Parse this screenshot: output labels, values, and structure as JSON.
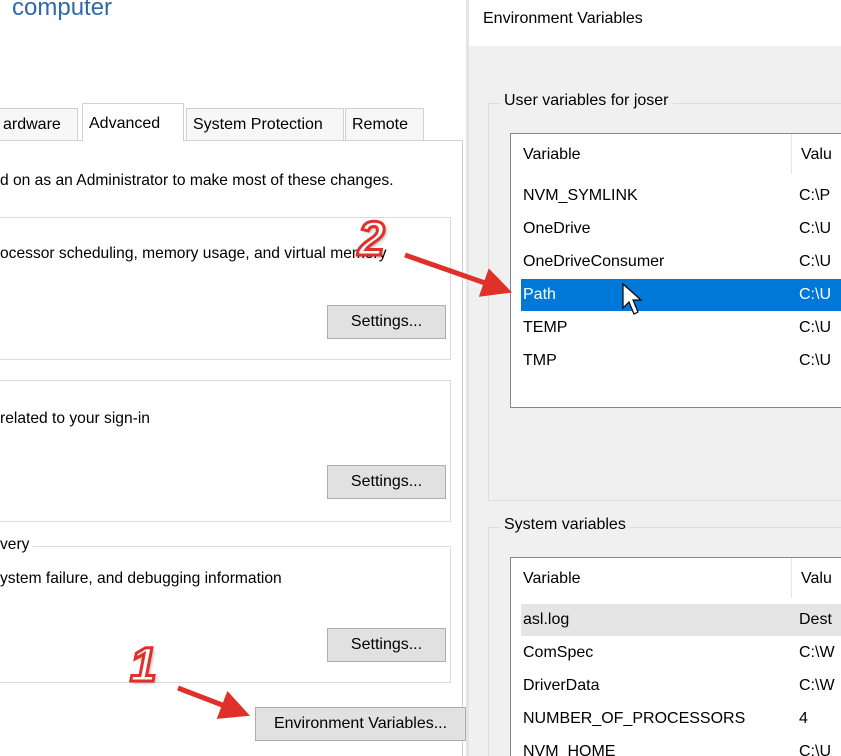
{
  "system_properties": {
    "title": "computer",
    "tabs": [
      {
        "label": "ardware",
        "active": false
      },
      {
        "label": "Advanced",
        "active": true
      },
      {
        "label": "System Protection",
        "active": false
      },
      {
        "label": "Remote",
        "active": false
      }
    ],
    "admin_note": "d on as an Administrator to make most of these changes.",
    "performance_desc": "ocessor scheduling, memory usage, and virtual memory",
    "profiles_desc": "related to your sign-in",
    "startup_legend": "very",
    "startup_desc": "ystem failure, and debugging information",
    "settings_label": "Settings...",
    "env_button_label": "Environment Variables..."
  },
  "environment_variables": {
    "title": "Environment Variables",
    "user_group_label": "User variables for joser",
    "system_group_label": "System variables",
    "column_variable": "Variable",
    "column_value": "Valu",
    "user_rows": [
      {
        "variable": "NVM_SYMLINK",
        "value": "C:\\P",
        "state": "normal"
      },
      {
        "variable": "OneDrive",
        "value": "C:\\U",
        "state": "normal"
      },
      {
        "variable": "OneDriveConsumer",
        "value": "C:\\U",
        "state": "normal"
      },
      {
        "variable": "Path",
        "value": "C:\\U",
        "state": "selected"
      },
      {
        "variable": "TEMP",
        "value": "C:\\U",
        "state": "normal"
      },
      {
        "variable": "TMP",
        "value": "C:\\U",
        "state": "normal"
      }
    ],
    "system_rows": [
      {
        "variable": "asl.log",
        "value": "Dest",
        "state": "hover"
      },
      {
        "variable": "ComSpec",
        "value": "C:\\W",
        "state": "normal"
      },
      {
        "variable": "DriverData",
        "value": "C:\\W",
        "state": "normal"
      },
      {
        "variable": "NUMBER_OF_PROCESSORS",
        "value": "4",
        "state": "normal"
      },
      {
        "variable": "NVM_HOME",
        "value": "C:\\U",
        "state": "normal"
      }
    ]
  },
  "annotations": {
    "step1": "1",
    "step2": "2",
    "arrow_color": "#e0302a"
  },
  "colors": {
    "selection": "#0078d7",
    "title_blue": "#2f6aa8"
  }
}
